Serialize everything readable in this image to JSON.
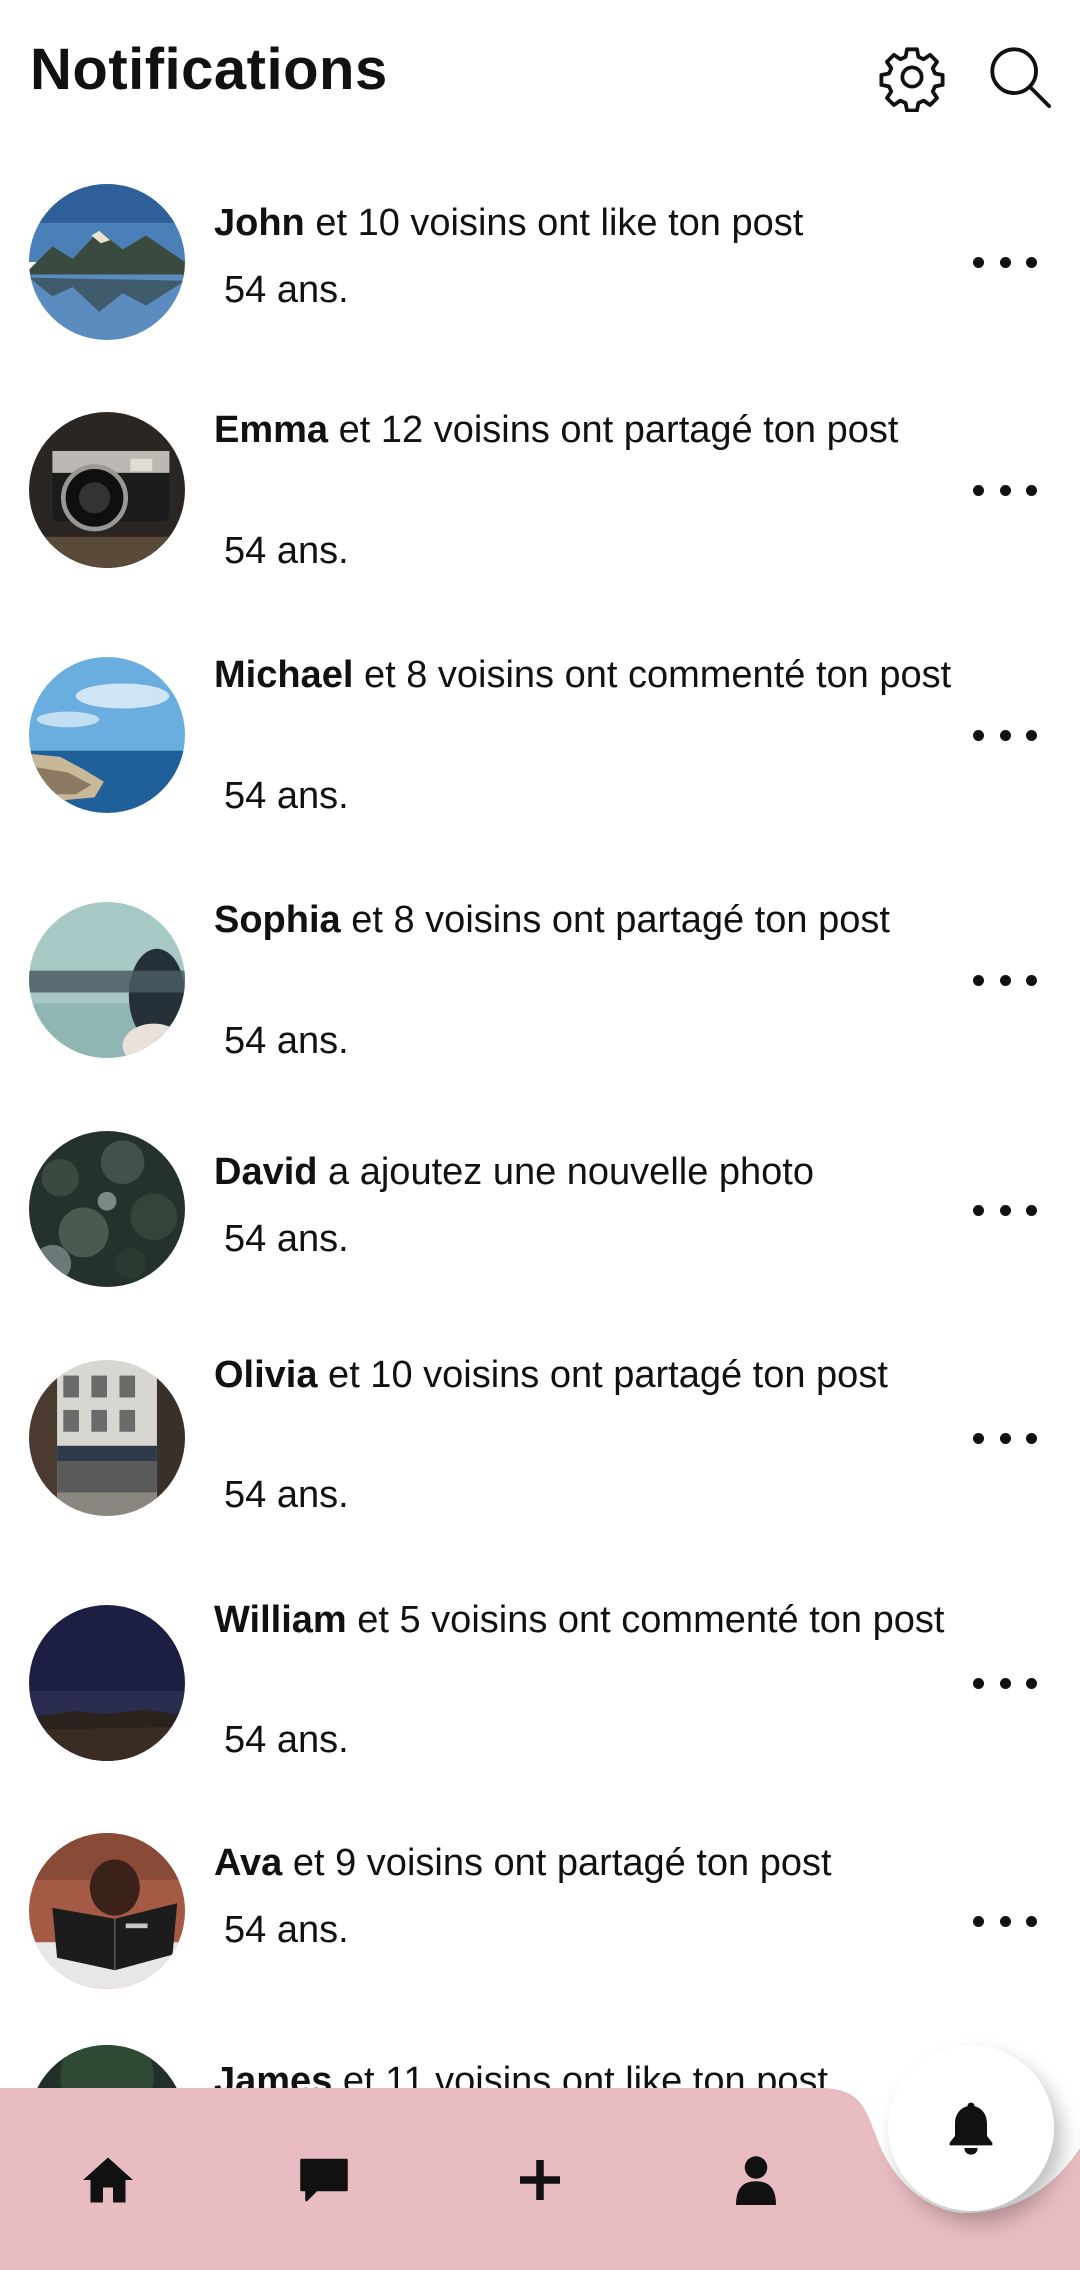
{
  "header": {
    "title": "Notifications",
    "settings_icon": "gear-icon",
    "search_icon": "search-icon"
  },
  "notifications": [
    {
      "name": "John",
      "text": " et 10 voisins ont like ton post",
      "age": "54 ans.",
      "avatar": "mountain-lake-photo"
    },
    {
      "name": "Emma",
      "text": " et 12 voisins ont partagé ton post",
      "age": "54 ans.",
      "avatar": "camera-photo"
    },
    {
      "name": "Michael",
      "text": " et 8 voisins ont commenté ton post",
      "age": "54 ans.",
      "avatar": "coast-photo"
    },
    {
      "name": "Sophia",
      "text": " et 8 voisins ont partagé ton post",
      "age": "54 ans.",
      "avatar": "blindfold-photo"
    },
    {
      "name": "David",
      "text": " a ajoutez une nouvelle photo",
      "age": "54 ans.",
      "avatar": "forest-photo"
    },
    {
      "name": "Olivia",
      "text": " et 10 voisins ont partagé ton post",
      "age": "54 ans.",
      "avatar": "street-photo"
    },
    {
      "name": "William",
      "text": " et 5 voisins ont commenté ton post",
      "age": "54 ans.",
      "avatar": "night-sky-photo"
    },
    {
      "name": "Ava",
      "text": " et 9 voisins ont partagé ton post",
      "age": "54 ans.",
      "avatar": "reading-photo"
    },
    {
      "name": "James",
      "text": " et 11 voisins ont like ton post",
      "age": "",
      "avatar": "dark-landscape-photo"
    }
  ],
  "bottom_nav": {
    "background": "#e8bcc0",
    "items": [
      "home-icon",
      "chat-icon",
      "add-icon",
      "profile-icon"
    ],
    "active": "bell-icon"
  },
  "colors": {
    "text": "#111111",
    "nav_bg": "#e8bcc0",
    "fab_bg": "#ffffff"
  }
}
